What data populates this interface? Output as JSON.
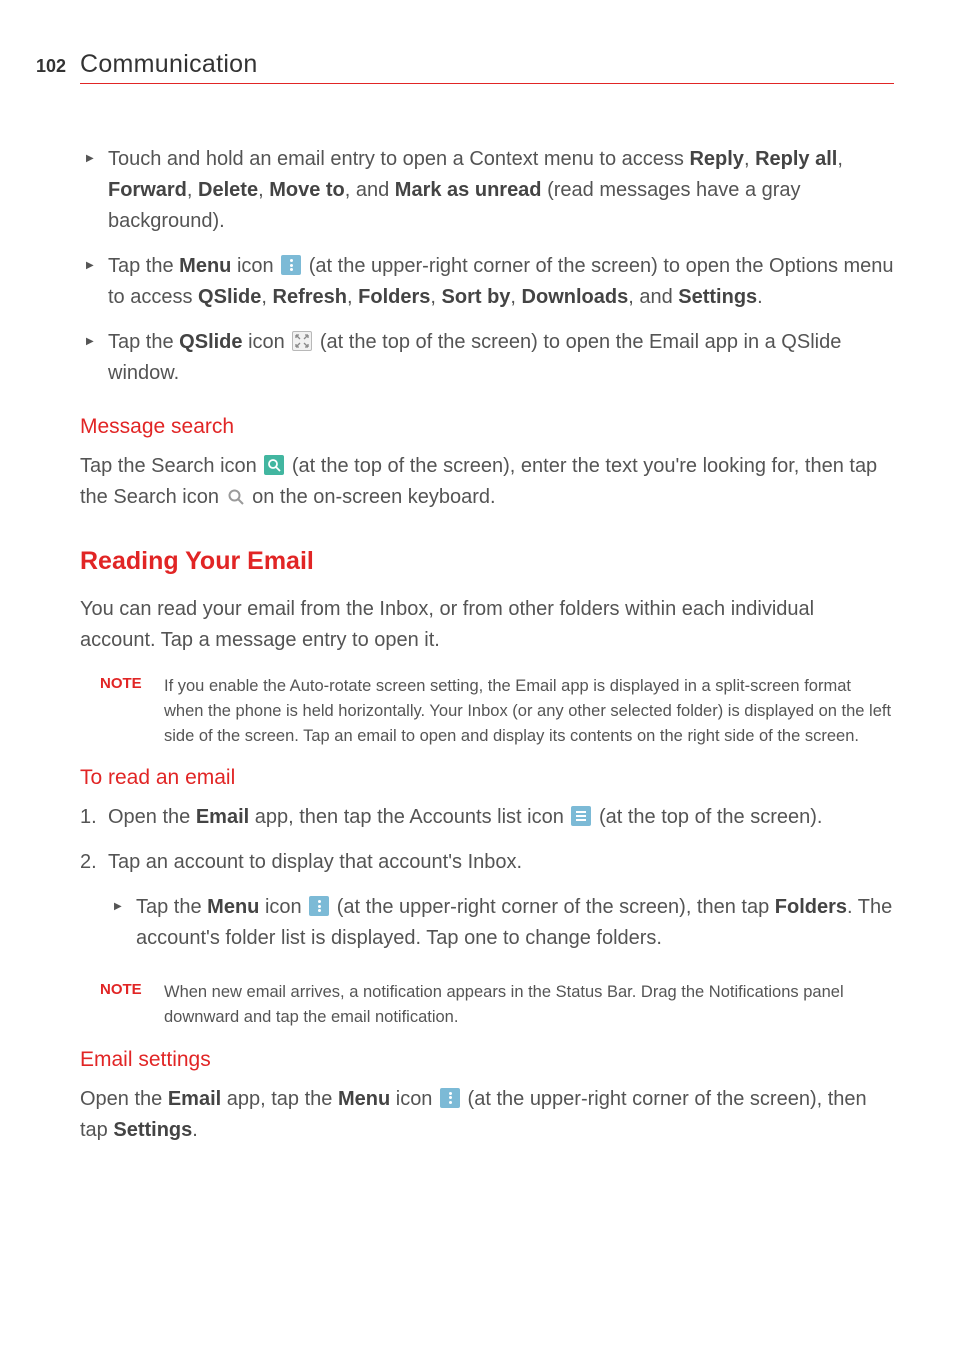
{
  "header": {
    "page_number": "102",
    "chapter": "Communication"
  },
  "bullets_top": {
    "b1": {
      "pre": "Touch and hold an email entry to open a Context menu to access ",
      "reply": "Reply",
      "c1": ", ",
      "reply_all": "Reply all",
      "c2": ", ",
      "forward": "Forward",
      "c3": ", ",
      "delete": "Delete",
      "c4": ", ",
      "move_to": "Move to",
      "c5": ", and ",
      "mark": "Mark as unread",
      "tail": " (read messages have a gray background)."
    },
    "b2": {
      "pre": "Tap the ",
      "menu": "Menu",
      "t1": " icon ",
      "t2": " (at the upper-right corner of the screen) to open the Options menu to access ",
      "qslide": "QSlide",
      "c1": ", ",
      "refresh": "Refresh",
      "c2": ", ",
      "folders": "Folders",
      "c3": ", ",
      "sortby": "Sort by",
      "c4": ", ",
      "downloads": "Downloads",
      "c5": ", and ",
      "settings": "Settings",
      "tail": "."
    },
    "b3": {
      "pre": "Tap the ",
      "qslide": "QSlide",
      "t1": " icon ",
      "tail": " (at the top of the screen) to open the Email app in a QSlide window."
    }
  },
  "section_search": {
    "heading": "Message search",
    "p1a": "Tap the Search icon ",
    "p1b": " (at the top of the screen), enter the text you're looking for, then tap the Search icon ",
    "p1c": " on the on-screen keyboard."
  },
  "section_reading": {
    "heading": "Reading Your Email",
    "intro": "You can read your email from the Inbox, or from other folders within each individual account. Tap a message entry to open it.",
    "note_label": "NOTE",
    "note_body": "If you enable the Auto-rotate screen setting, the Email app is displayed in a split-screen format when the phone is held horizontally. Your Inbox (or any other selected folder) is displayed on the left side of the screen. Tap an email to open and display its contents on the right side of the screen."
  },
  "section_toread": {
    "heading": "To read an email",
    "s1": {
      "pre": "Open the ",
      "email": "Email",
      "mid": " app, then tap the Accounts list icon ",
      "tail": " (at the top of the screen)."
    },
    "s2": {
      "text": "Tap an account to display that account's Inbox."
    },
    "s2b": {
      "pre": "Tap the ",
      "menu": "Menu",
      "t1": " icon ",
      "t2": " (at the upper-right corner of the screen), then tap ",
      "folders": "Folders",
      "tail": ". The account's folder list is displayed. Tap one to change folders."
    },
    "note_label": "NOTE",
    "note_body": "When new email arrives, a notification appears in the Status Bar. Drag the Notifications panel downward and tap the email notification."
  },
  "section_settings": {
    "heading": "Email settings",
    "p": {
      "pre": "Open the ",
      "email": "Email",
      "t1": " app, tap the ",
      "menu": "Menu",
      "t2": " icon ",
      "t3": " (at the upper-right corner of the screen), then tap ",
      "settings": "Settings",
      "tail": "."
    }
  }
}
